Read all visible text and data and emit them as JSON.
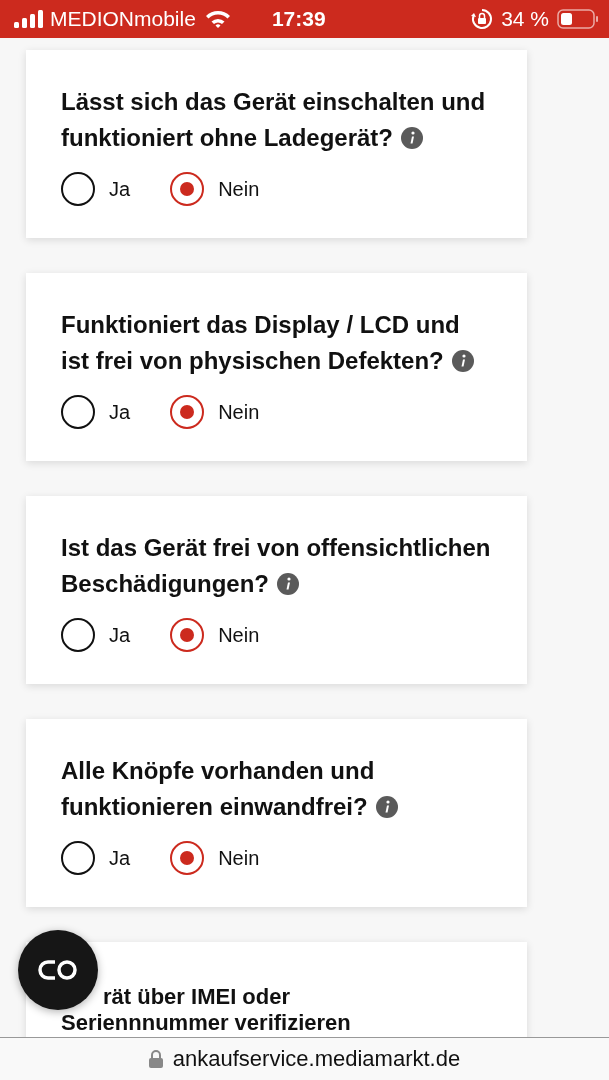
{
  "status_bar": {
    "carrier": "MEDIONmobile",
    "time": "17:39",
    "battery": "34 %"
  },
  "questions": [
    {
      "title": "Lässt sich das Gerät einschalten und funktioniert ohne Ladegerät?",
      "options": [
        {
          "label": "Ja",
          "selected": false
        },
        {
          "label": "Nein",
          "selected": true
        }
      ]
    },
    {
      "title": "Funktioniert das Display / LCD und ist frei von physischen Defekten?",
      "options": [
        {
          "label": "Ja",
          "selected": false
        },
        {
          "label": "Nein",
          "selected": true
        }
      ]
    },
    {
      "title": "Ist das Gerät frei von offensichtlichen Beschädigungen?",
      "options": [
        {
          "label": "Ja",
          "selected": false
        },
        {
          "label": "Nein",
          "selected": true
        }
      ]
    },
    {
      "title": "Alle Knöpfe vorhanden und funktionieren einwandfrei?",
      "options": [
        {
          "label": "Ja",
          "selected": false
        },
        {
          "label": "Nein",
          "selected": true
        }
      ]
    }
  ],
  "partial_question": {
    "lines": [
      "rät über IMEI oder",
      "Seriennnummer verifizieren"
    ]
  },
  "url_bar": {
    "url": "ankaufservice.mediamarkt.de"
  }
}
